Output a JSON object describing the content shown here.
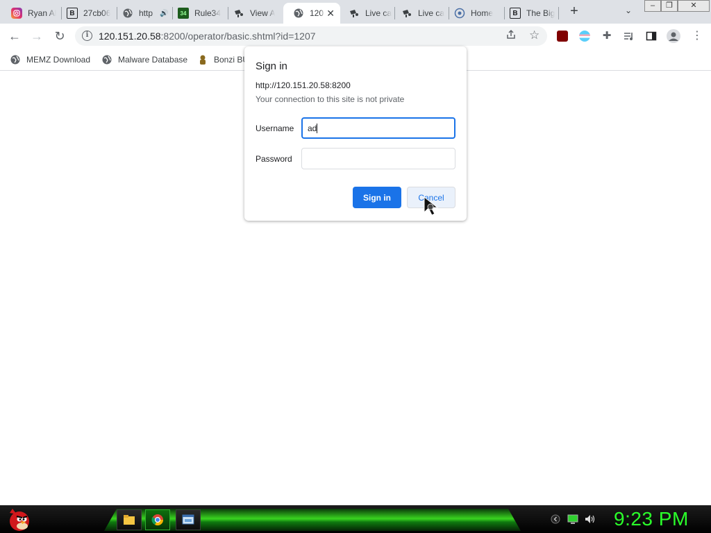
{
  "tabs": [
    {
      "title": "Ryan Al",
      "icon": "instagram-icon"
    },
    {
      "title": "27cb06",
      "icon": "b-logo-icon"
    },
    {
      "title": "http",
      "icon": "globe-icon"
    },
    {
      "title": "Rule34",
      "icon": "r34-icon"
    },
    {
      "title": "View A",
      "icon": "camera-icon"
    },
    {
      "title": "120",
      "icon": "globe-icon"
    },
    {
      "title": "Live ca",
      "icon": "camera-icon"
    },
    {
      "title": "Live ca",
      "icon": "camera-icon"
    },
    {
      "title": "Home",
      "icon": "globe-icon"
    },
    {
      "title": "The Big",
      "icon": "b-logo-icon"
    }
  ],
  "omnibox": {
    "host": "120.151.20.58",
    "path": ":8200/operator/basic.shtml?id=1207"
  },
  "bookmarks": [
    {
      "label": "MEMZ Download"
    },
    {
      "label": "Malware Database"
    },
    {
      "label": "Bonzi BU"
    }
  ],
  "dialog": {
    "title": "Sign in",
    "origin": "http://120.151.20.58:8200",
    "warning": "Your connection to this site is not private",
    "username_label": "Username",
    "username_value": "ad",
    "password_label": "Password",
    "password_value": "",
    "signin_label": "Sign in",
    "cancel_label": "Cancel"
  },
  "taskbar": {
    "clock": "9:23 PM"
  },
  "colors": {
    "accent": "#1a73e8",
    "taskbar_green": "#39d41f",
    "clock_green": "#2aff2a"
  }
}
